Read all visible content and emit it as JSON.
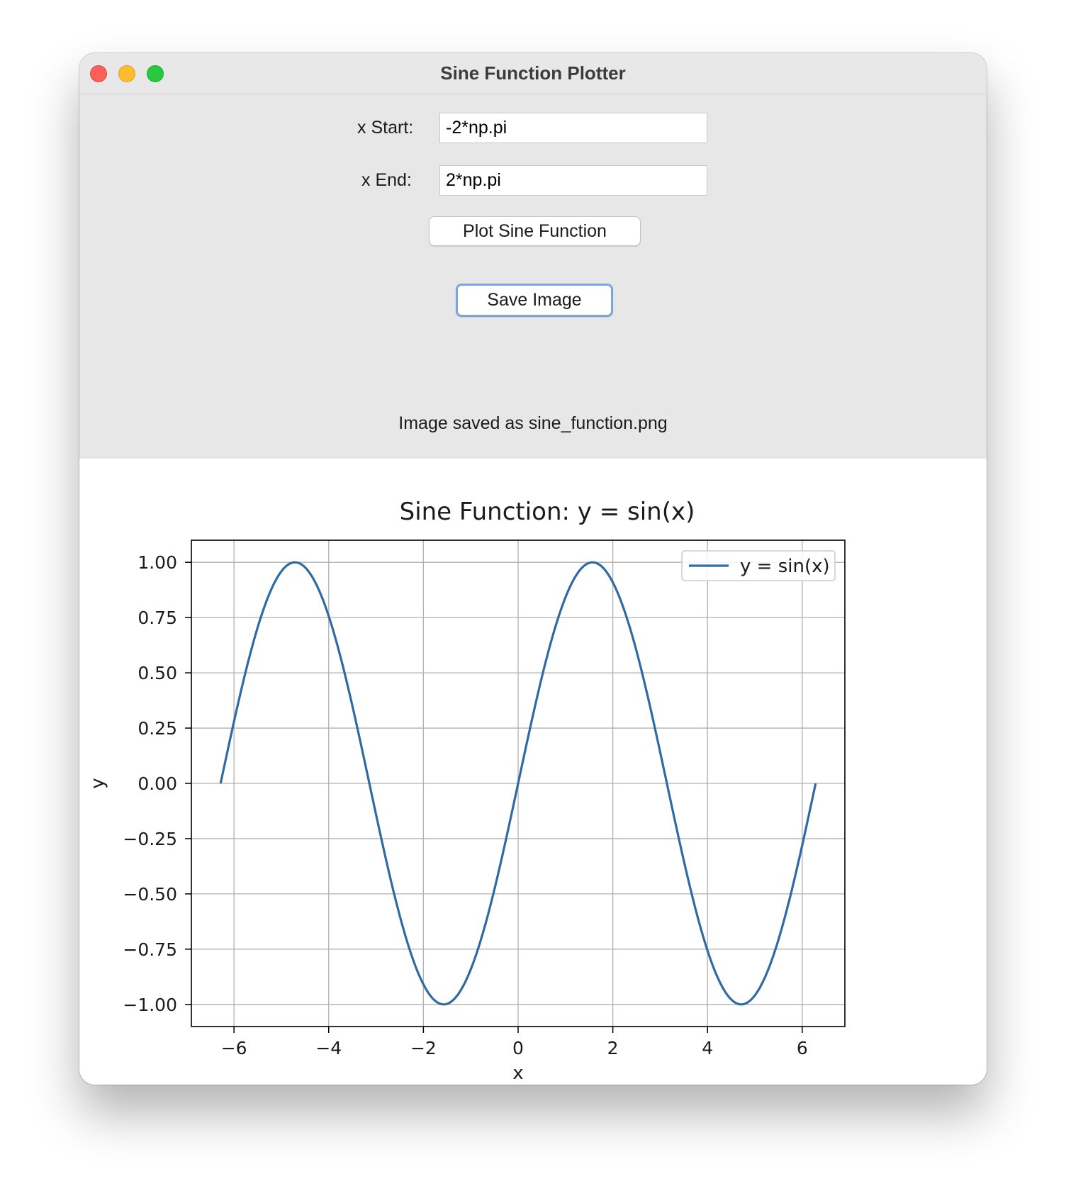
{
  "window": {
    "title": "Sine Function Plotter"
  },
  "form": {
    "x_start_label": "x Start:",
    "x_start_value": "-2*np.pi",
    "x_end_label": "x End:",
    "x_end_value": "2*np.pi",
    "plot_button": "Plot Sine Function",
    "save_button": "Save Image",
    "status": "Image saved as sine_function.png"
  },
  "colors": {
    "line": "#2f6aa3",
    "controls_bg": "#e7e7e7"
  },
  "chart_data": {
    "type": "line",
    "title": "Sine Function: y = sin(x)",
    "xlabel": "x",
    "ylabel": "y",
    "xlim": [
      -6.9,
      6.9
    ],
    "ylim": [
      -1.1,
      1.1
    ],
    "x_ticks": [
      -6,
      -4,
      -2,
      0,
      2,
      4,
      6
    ],
    "x_tick_labels": [
      "−6",
      "−4",
      "−2",
      "0",
      "2",
      "4",
      "6"
    ],
    "y_ticks": [
      1.0,
      0.75,
      0.5,
      0.25,
      0.0,
      -0.25,
      -0.5,
      -0.75,
      -1.0
    ],
    "y_tick_labels": [
      "1.00",
      "0.75",
      "0.50",
      "0.25",
      "0.00",
      "−0.25",
      "−0.50",
      "−0.75",
      "−1.00"
    ],
    "grid": true,
    "legend": "top-right",
    "series": [
      {
        "name": "y = sin(x)",
        "function": "sin",
        "x_range": [
          -6.283185,
          6.283185
        ],
        "x": [
          -6.283,
          -5.498,
          -4.712,
          -3.927,
          -3.142,
          -2.356,
          -1.571,
          -0.785,
          0.0,
          0.785,
          1.571,
          2.356,
          3.142,
          3.927,
          4.712,
          5.498,
          6.283
        ],
        "y": [
          0.0,
          0.707,
          1.0,
          0.707,
          0.0,
          -0.707,
          -1.0,
          -0.707,
          0.0,
          0.707,
          1.0,
          0.707,
          0.0,
          -0.707,
          -1.0,
          -0.707,
          0.0
        ]
      }
    ]
  }
}
